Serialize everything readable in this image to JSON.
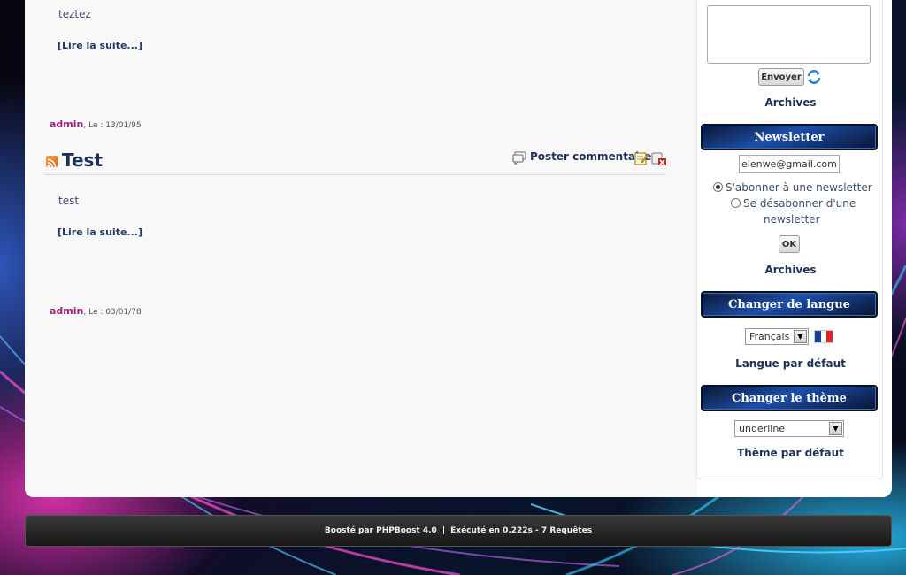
{
  "posts": [
    {
      "body": "teztez",
      "read_more": "[Lire la suite...]",
      "author": "admin",
      "date_label": ", Le : 13/01/95"
    },
    {
      "title": "Test",
      "comment_label": "Poster commentaire",
      "body": "test",
      "read_more": "[Lire la suite...]",
      "author": "admin",
      "date_label": ", Le : 03/01/78"
    }
  ],
  "sidebar": {
    "shoutbox": {
      "send_label": "Envoyer",
      "archives_label": "Archives"
    },
    "newsletter": {
      "title": "Newsletter",
      "email_value": "elenwe@gmail.com",
      "subscribe_label": "S'abonner à une newsletter",
      "unsubscribe_label_1": "Se désabonner d'une",
      "unsubscribe_label_2": "newsletter",
      "ok_label": "OK",
      "archives_label": "Archives"
    },
    "language": {
      "title": "Changer de langue",
      "selected": "Français",
      "default_label": "Langue par défaut"
    },
    "theme": {
      "title": "Changer le thème",
      "selected": "underline",
      "default_label": "Thème par défaut"
    }
  },
  "footer": {
    "powered_by": "Boosté par PHPBoost 4.0",
    "separator": "|",
    "execution": "Exécuté en 0.222s - 7 Requêtes"
  },
  "colors": {
    "link": "#1c3158",
    "author": "#a0207a",
    "menu_title_bg": "#1d4ea8"
  }
}
